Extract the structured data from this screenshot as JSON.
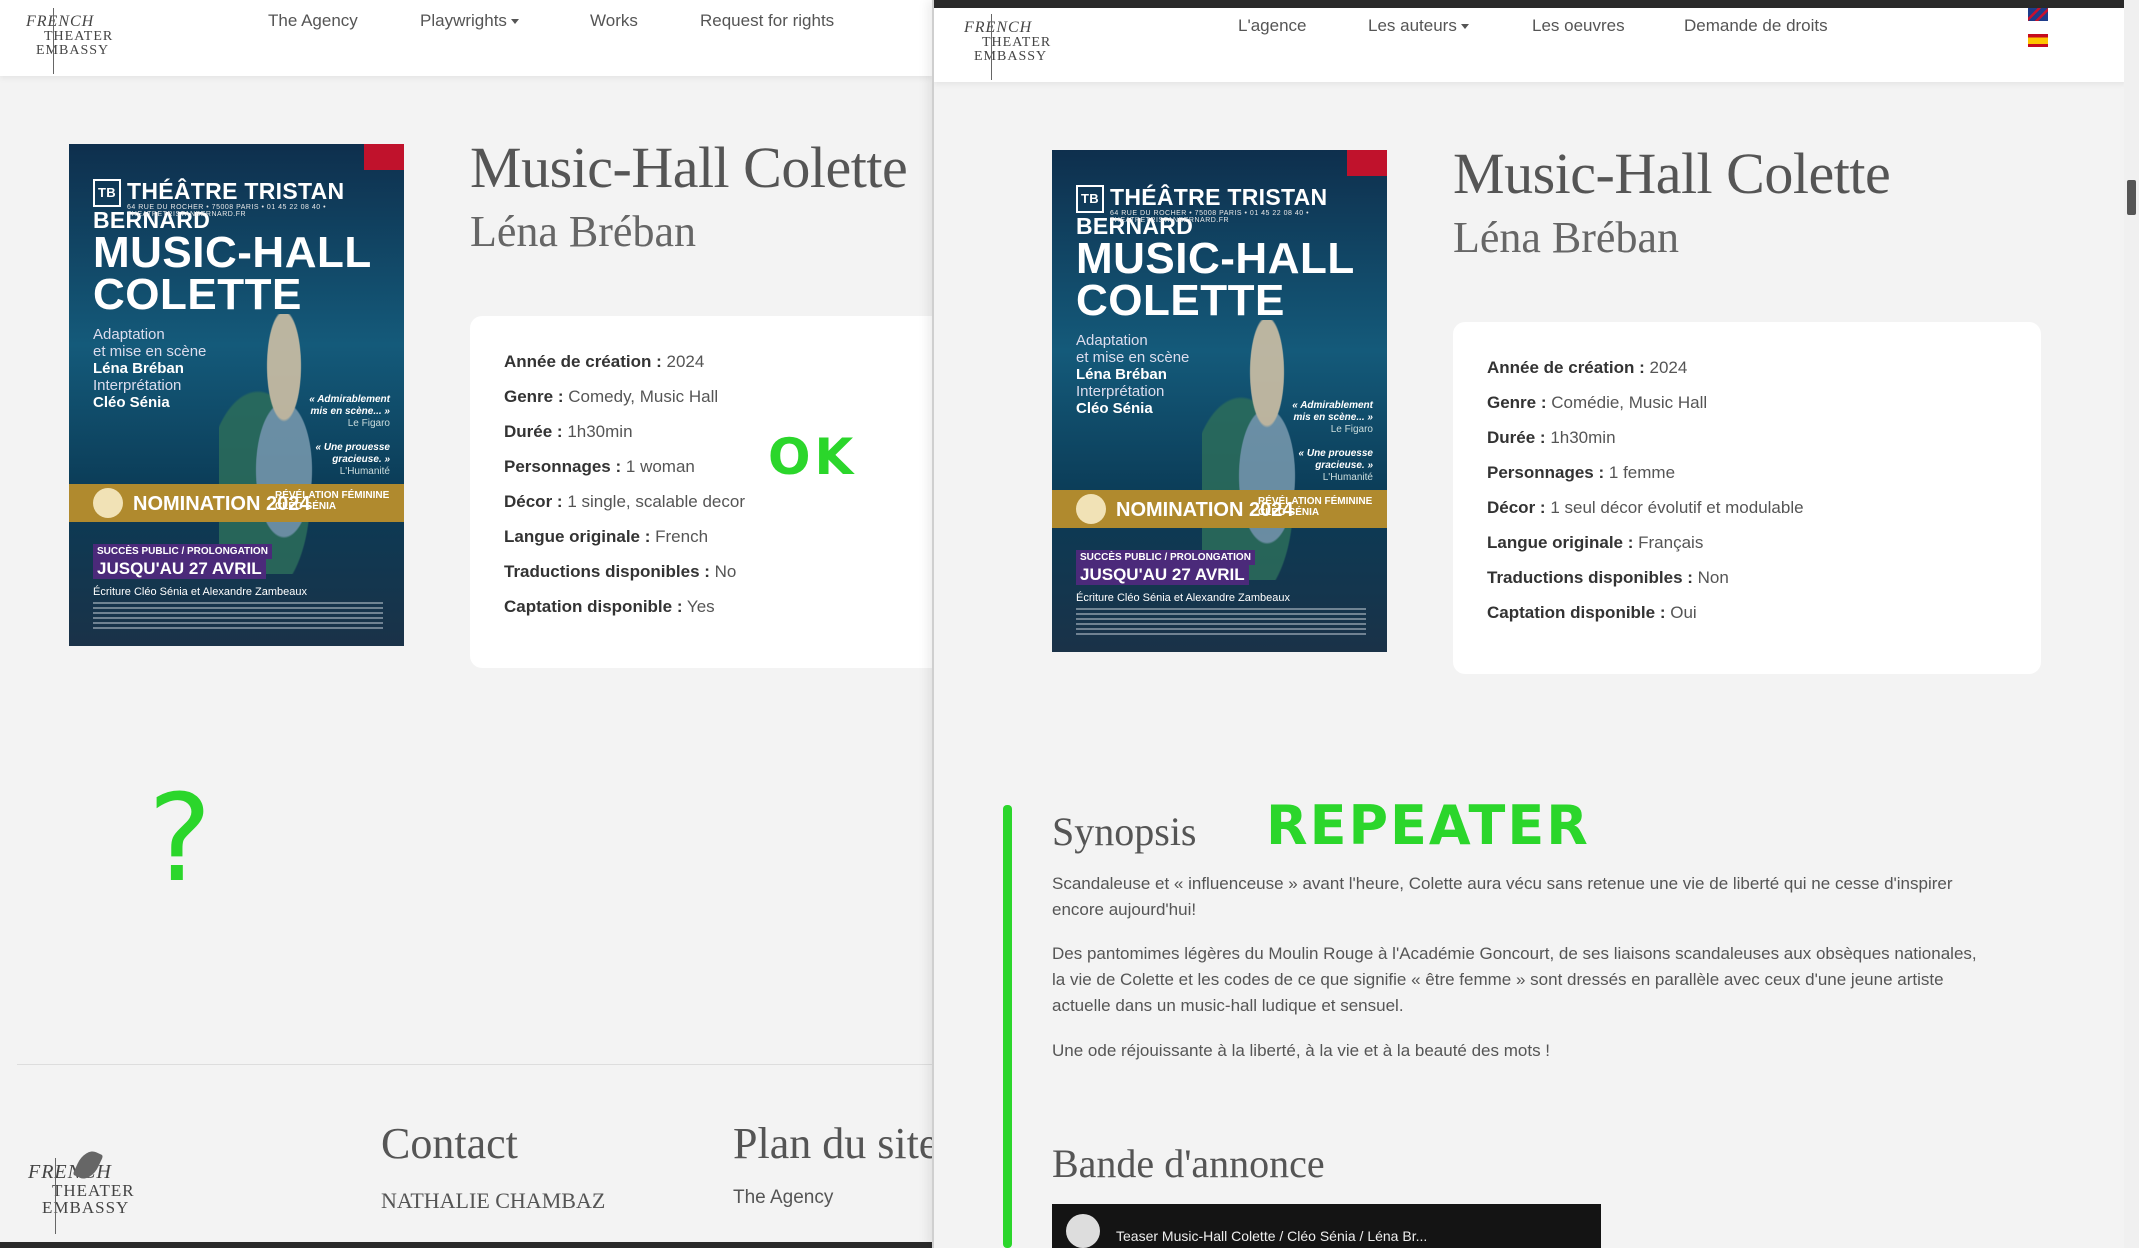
{
  "logo": {
    "line1": "FRENCH",
    "line2": "THEATER",
    "line3": "EMBASSY"
  },
  "left": {
    "nav": [
      "The Agency",
      "Playwrights",
      "Works",
      "Request for rights"
    ],
    "title": "Music-Hall Colette",
    "author": "Léna Bréban",
    "specs": [
      {
        "label": "Année de création :",
        "value": "2024"
      },
      {
        "label": "Genre :",
        "value": "Comedy, Music Hall"
      },
      {
        "label": "Durée :",
        "value": "1h30min"
      },
      {
        "label": "Personnages :",
        "value": "1 woman"
      },
      {
        "label": "Décor :",
        "value": "1 single, scalable decor"
      },
      {
        "label": "Langue originale :",
        "value": "French"
      },
      {
        "label": "Traductions disponibles :",
        "value": "No"
      },
      {
        "label": "Captation disponible :",
        "value": "Yes"
      }
    ],
    "footer": {
      "contact_title": "Contact",
      "contact_name": "NATHALIE CHAMBAZ",
      "sitemap_title": "Plan du site",
      "sitemap_link": "The Agency"
    }
  },
  "right": {
    "nav": [
      "L'agence",
      "Les auteurs",
      "Les oeuvres",
      "Demande de droits"
    ],
    "title": "Music-Hall Colette",
    "author": "Léna Bréban",
    "specs": [
      {
        "label": "Année de création :",
        "value": "2024"
      },
      {
        "label": "Genre :",
        "value": "Comédie, Music Hall"
      },
      {
        "label": "Durée :",
        "value": "1h30min"
      },
      {
        "label": "Personnages :",
        "value": "1 femme"
      },
      {
        "label": "Décor :",
        "value": "1 seul décor évolutif et modulable"
      },
      {
        "label": "Langue originale :",
        "value": "Français"
      },
      {
        "label": "Traductions disponibles :",
        "value": "Non"
      },
      {
        "label": "Captation disponible :",
        "value": "Oui"
      }
    ],
    "synopsis_title": "Synopsis",
    "synopsis": [
      "Scandaleuse et « influenceuse » avant l'heure, Colette aura vécu sans retenue une vie de liberté qui ne cesse d'inspirer encore aujourd'hui!",
      "Des pantomimes légères du Moulin Rouge à l'Académie Goncourt, de ses liaisons scandaleuses aux obsèques nationales, la vie de Colette et les codes de ce que signifie « être femme » sont dressés en parallèle avec ceux d'une jeune artiste actuelle dans un music-hall ludique et sensuel.",
      "Une ode réjouissante à la liberté, à la vie et à la beauté des mots !"
    ],
    "trailer_title": "Bande d'annonce",
    "video_title": "Teaser Music-Hall Colette / Cléo Sénia / Léna Br..."
  },
  "poster": {
    "theatre": "THÉÂTRE TRISTAN BERNARD",
    "address": "64 RUE DU ROCHER • 75008 PARIS • 01 45 22 08 40 • THEATRETRISTANBERNARD.FR",
    "title_line1": "MUSIC-HALL",
    "title_line2": "COLETTE",
    "adapt": "Adaptation",
    "mise": "et mise en scène",
    "director": "Léna Bréban",
    "interp": "Interprétation",
    "actor": "Cléo Sénia",
    "quote1": "« Admirablement mis en scène... »",
    "quote1_src": "Le Figaro",
    "quote2": "« Une prouesse gracieuse. »",
    "quote2_src": "L'Humanité",
    "nomination": "NOMINATION 2024",
    "revelation": "RÉVÉLATION FÉMININE",
    "revelation_name": "CLÉO SÉNIA",
    "succes": "SUCCÈS PUBLIC / PROLONGATION",
    "until": "JUSQU'AU 27 AVRIL",
    "writing": "Écriture Cléo Sénia et Alexandre Zambeaux"
  },
  "annotations": {
    "ok": "OK",
    "question": "?",
    "repeater": "REPEATER"
  },
  "colors": {
    "annotation": "#2bd62b",
    "background": "#f3f3f3",
    "card": "#ffffff"
  }
}
